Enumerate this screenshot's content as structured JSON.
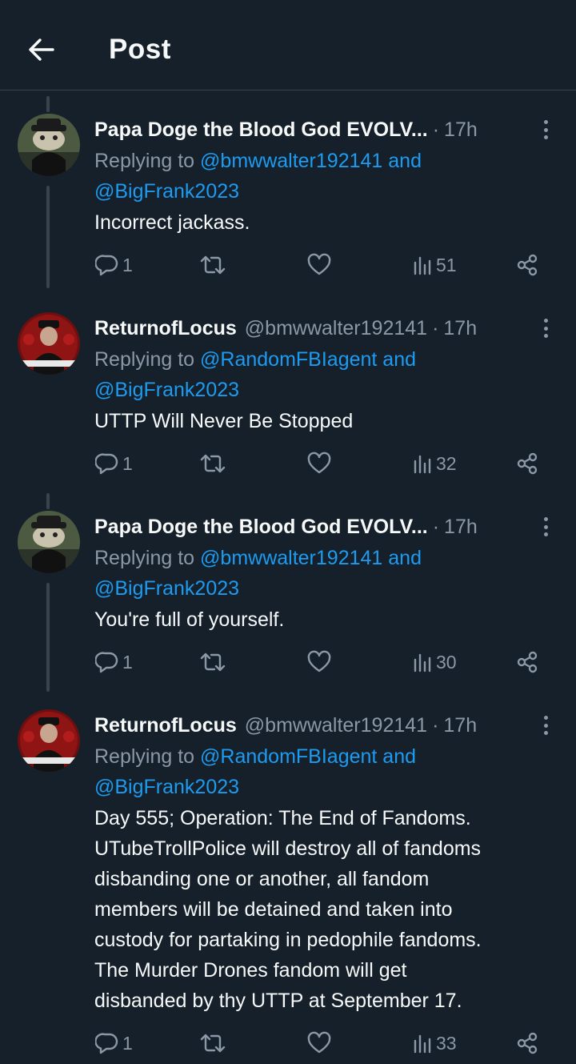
{
  "header": {
    "title": "Post"
  },
  "posts": [
    {
      "name": "Papa Doge the Blood God EVOLV...",
      "handle": "",
      "time": "17h",
      "reply_prefix": "Replying to ",
      "reply_mention1": "@bmwwalter192141",
      "reply_and": " and",
      "reply_mention2": "@BigFrank2023",
      "text": "Incorrect jackass.",
      "replies": "1",
      "views": "51"
    },
    {
      "name": "ReturnofLocus",
      "handle": "@bmwwalter192141",
      "time": "17h",
      "reply_prefix": "Replying to ",
      "reply_mention1": "@RandomFBIagent",
      "reply_and": " and",
      "reply_mention2": "@BigFrank2023",
      "text": "UTTP Will Never Be Stopped",
      "replies": "1",
      "views": "32"
    },
    {
      "name": "Papa Doge the Blood God EVOLV...",
      "handle": "",
      "time": "17h",
      "reply_prefix": "Replying to ",
      "reply_mention1": "@bmwwalter192141",
      "reply_and": " and",
      "reply_mention2": "@BigFrank2023",
      "text": "You're full of yourself.",
      "replies": "1",
      "views": "30"
    },
    {
      "name": "ReturnofLocus",
      "handle": "@bmwwalter192141",
      "time": "17h",
      "reply_prefix": "Replying to ",
      "reply_mention1": "@RandomFBIagent",
      "reply_and": " and",
      "reply_mention2": "@BigFrank2023",
      "text_lines": [
        "Day 555; Operation: The End of Fandoms.",
        "UTubeTrollPolice will destroy all of fandoms",
        "disbanding one or another, all fandom",
        "members will be detained and taken into",
        "custody for partaking in pedophile fandoms.",
        "The Murder Drones fandom will get",
        "disbanded by thy UTTP at September 17."
      ],
      "replies": "1",
      "views": "33"
    }
  ],
  "icons": {
    "back": "arrow-left-icon",
    "more": "more-vertical-icon",
    "reply": "reply-icon",
    "retweet": "retweet-icon",
    "like": "heart-icon",
    "views": "views-icon",
    "share": "share-icon"
  },
  "colors": {
    "background": "#15202b",
    "text": "#f7f9f9",
    "muted": "#8b98a5",
    "accent": "#1d9bf0",
    "divider": "#38444d"
  }
}
